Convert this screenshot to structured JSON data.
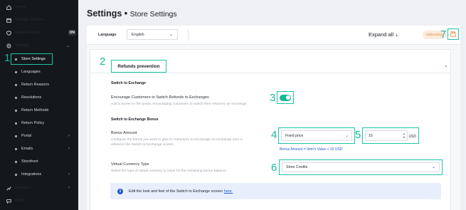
{
  "sidebar": {
    "items": [
      {
        "label": "Home",
        "icon": "home-icon"
      },
      {
        "label": "Manage Returns",
        "icon": "returns-icon"
      },
      {
        "label": "Return Guard",
        "icon": "shield-icon",
        "badge": "ON"
      },
      {
        "label": "Settings",
        "icon": "gear-icon"
      }
    ],
    "settings_sub": [
      {
        "label": "Store Settings"
      },
      {
        "label": "Languages"
      },
      {
        "label": "Return Reasons"
      },
      {
        "label": "Resolutions"
      },
      {
        "label": "Return Methods"
      },
      {
        "label": "Return Policy"
      },
      {
        "label": "Portal"
      },
      {
        "label": "Emails"
      },
      {
        "label": "Storefront"
      },
      {
        "label": "Integrations"
      }
    ],
    "bottom": [
      {
        "label": "Analytics",
        "icon": "analytics-icon"
      },
      {
        "label": "Chat",
        "icon": "chat-icon"
      }
    ]
  },
  "header": {
    "title": "Settings",
    "separator": "•",
    "subtitle": "Store Settings"
  },
  "toolbar": {
    "language_label": "Language",
    "language_value": "English",
    "expand_label": "Expand all",
    "unsaved_label": "UNSAVED"
  },
  "section": {
    "title": "Refunds prevention",
    "switch_heading": "Switch to Exchange",
    "encourage_label": "Encourage Customers to Switch Refunds to Exchanges",
    "encourage_hint": "Add a screen in the portal, encouraging customers to switch their refund to an exchange.",
    "encourage_enabled": true,
    "bonus_heading": "Switch to Exchange Bonus",
    "bonus_label": "Bonus Amount",
    "bonus_hint_1": "Configure the bonus you want to give to customers to encourage an exchange over a",
    "bonus_hint_2": "refund in the Switch to Exchange screen.",
    "bonus_type": "Fixed price",
    "bonus_value": "15",
    "bonus_currency": "USD",
    "bonus_formula": "Bonus Amount = Item's Value + 15 USD",
    "currency_label": "Virtual Currency Type",
    "currency_hint": "Select the type of virtual currency to issue for the remaining bonus balance.",
    "currency_value": "Store Credits",
    "info_text": "Edit the look and feel of the Switch to Exchange screen",
    "info_link": "here."
  },
  "markers": [
    "1",
    "2",
    "3",
    "4",
    "5",
    "6",
    "7"
  ],
  "colors": {
    "accent": "#17b89b",
    "link": "#1e5bd7",
    "sidebar": "#14171c",
    "warning": "#e2832d"
  }
}
